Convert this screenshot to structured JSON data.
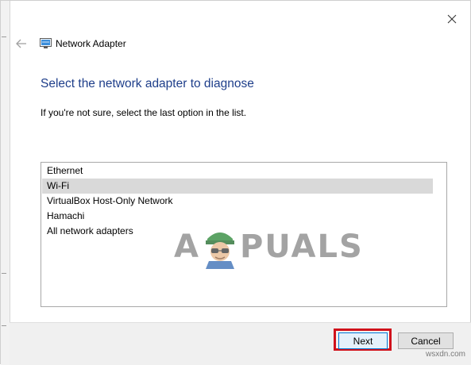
{
  "window": {
    "title": "Network Adapter",
    "close_icon": "close-icon",
    "back_icon": "back-arrow-icon",
    "title_icon": "network-adapter-icon"
  },
  "content": {
    "heading": "Select the network adapter to diagnose",
    "instruction": "If you're not sure, select the last option in the list.",
    "adapters": [
      {
        "label": "Ethernet",
        "selected": false
      },
      {
        "label": "Wi-Fi",
        "selected": true
      },
      {
        "label": "VirtualBox Host-Only Network",
        "selected": false
      },
      {
        "label": "Hamachi",
        "selected": false
      },
      {
        "label": "All network adapters",
        "selected": false
      }
    ]
  },
  "buttons": {
    "next_label": "Next",
    "cancel_label": "Cancel"
  },
  "watermark": {
    "left": "A",
    "right": "PUALS"
  },
  "site_label": "wsxdn.com",
  "colors": {
    "heading": "#1e3e8a",
    "selection": "#d9d9d9",
    "highlight": "#d0111b",
    "footer": "#f0f0f0"
  }
}
